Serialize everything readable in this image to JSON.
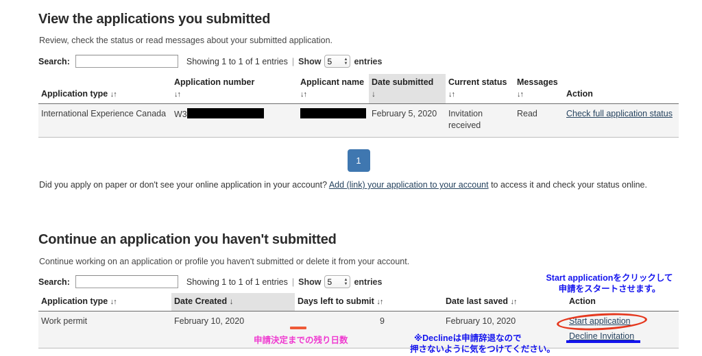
{
  "submitted_section": {
    "title": "View the applications you submitted",
    "subtitle": "Review, check the status or read messages about your submitted application.",
    "search_label": "Search:",
    "search_value": "",
    "search_placeholder": "",
    "showing_text": "Showing 1 to 1 of 1 entries",
    "show_word": "Show",
    "entries_value": "5",
    "entries_word": "entries",
    "columns": [
      {
        "label": "Application type",
        "sort": "both"
      },
      {
        "label": "Application number",
        "sort": "both"
      },
      {
        "label": "Applicant name",
        "sort": "both"
      },
      {
        "label": "Date submitted",
        "sort": "desc"
      },
      {
        "label": "Current status",
        "sort": "both"
      },
      {
        "label": "Messages",
        "sort": "both"
      },
      {
        "label": "Action",
        "sort": "none"
      }
    ],
    "row": {
      "application_type": "International Experience Canada",
      "application_number_prefix": "W3",
      "application_number_redacted": true,
      "applicant_name_redacted": true,
      "date_submitted": "February 5, 2020",
      "current_status": "Invitation received",
      "messages": "Read",
      "action_label": "Check full application status"
    },
    "pagination": {
      "current_page": "1"
    }
  },
  "paper_note": {
    "before": "Did you apply on paper or don't see your online application in your account?",
    "link": "Add (link) your application to your account",
    "after": "to access it and check your status online."
  },
  "continue_section": {
    "title": "Continue an application you haven't submitted",
    "subtitle": "Continue working on an application or profile you haven't submitted or delete it from your account.",
    "search_label": "Search:",
    "search_value": "",
    "search_placeholder": "",
    "showing_text": "Showing 1 to 1 of 1 entries",
    "show_word": "Show",
    "entries_value": "5",
    "entries_word": "entries",
    "columns": [
      {
        "label": "Application type",
        "sort": "both"
      },
      {
        "label": "Date Created",
        "sort": "desc"
      },
      {
        "label": "Days left to submit",
        "sort": "both"
      },
      {
        "label": "Date last saved",
        "sort": "both"
      },
      {
        "label": "Action",
        "sort": "none"
      }
    ],
    "row": {
      "application_type": "Work permit",
      "date_created": "February 10, 2020",
      "days_left": "9",
      "date_last_saved": "February 10, 2020",
      "action_start": "Start application",
      "action_decline": "Decline Invitation"
    }
  },
  "icons": {
    "sort_both": "↓↑",
    "sort_desc": "↓",
    "stepper_up": "▲",
    "stepper_down": "▼"
  },
  "annotations": {
    "start_note_line1": "Start applicationをクリックして",
    "start_note_line2": "申請をスタートさせます。",
    "days_note": "申請決定までの残り日数",
    "decline_note_line1": "※Declineは申請辞退なので",
    "decline_note_line2": "押さないように気をつけてください。"
  },
  "colors": {
    "pager_blue": "#3f77b0",
    "link_blue": "#26435f",
    "anno_blue": "#1414ee",
    "anno_pink": "#ef3ad0",
    "anno_red": "#e5381e",
    "underline_orange": "#ee5a37",
    "row_bg": "#f4f4f4",
    "sorted_header_bg": "#e2e2e2"
  }
}
